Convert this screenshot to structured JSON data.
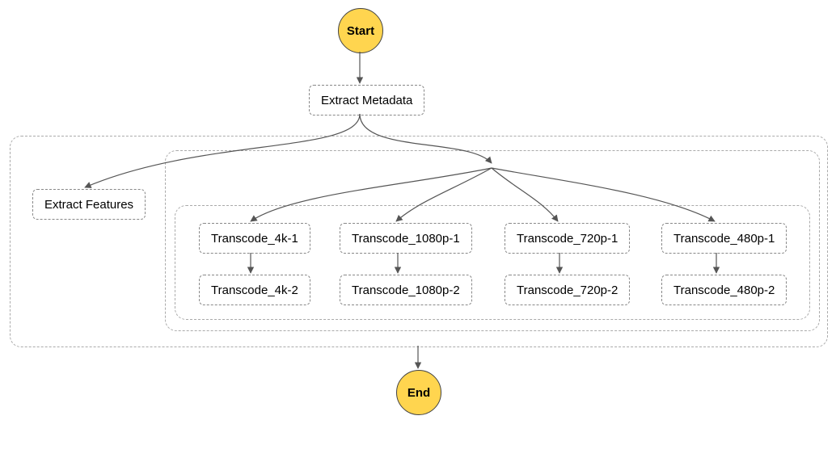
{
  "nodes": {
    "start": "Start",
    "end": "End",
    "extract_metadata": "Extract Metadata",
    "extract_features": "Extract Features",
    "t4k1": "Transcode_4k-1",
    "t4k2": "Transcode_4k-2",
    "t1080_1": "Transcode_1080p-1",
    "t1080_2": "Transcode_1080p-2",
    "t720_1": "Transcode_720p-1",
    "t720_2": "Transcode_720p-2",
    "t480_1": "Transcode_480p-1",
    "t480_2": "Transcode_480p-2"
  }
}
